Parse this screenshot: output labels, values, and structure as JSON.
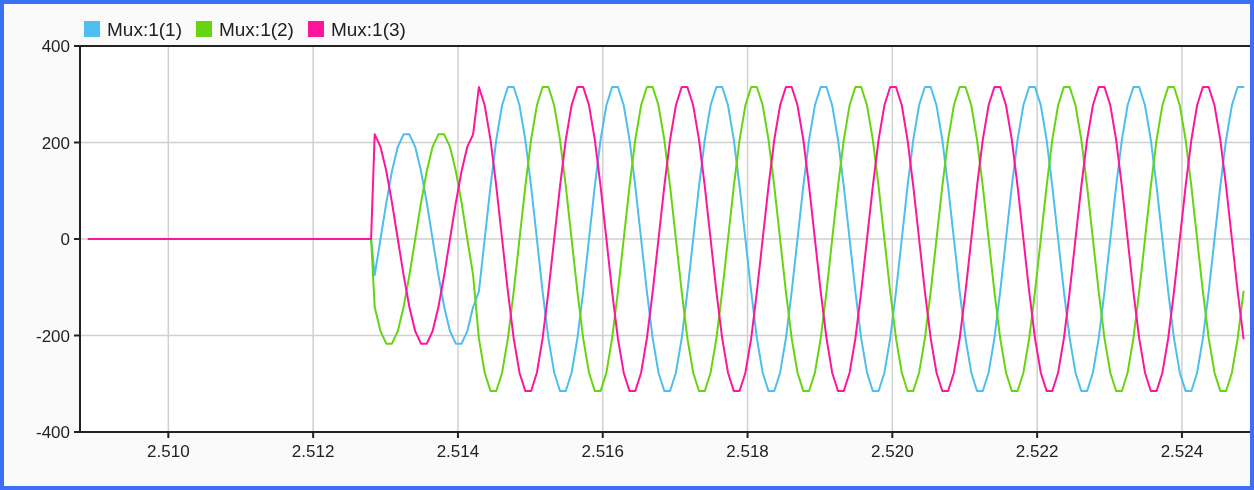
{
  "scope": {
    "chart_data": {
      "type": "line",
      "grid": true,
      "xlim": [
        2.50878,
        2.52494
      ],
      "ylim": [
        -400,
        400
      ],
      "yticks": [
        -400,
        -200,
        0,
        200,
        400
      ],
      "xticks": [
        {
          "value": 2.51,
          "label": "2.510"
        },
        {
          "value": 2.512,
          "label": "2.512"
        },
        {
          "value": 2.514,
          "label": "2.514"
        },
        {
          "value": 2.516,
          "label": "2.516"
        },
        {
          "value": 2.518,
          "label": "2.518"
        },
        {
          "value": 2.52,
          "label": "2.520"
        },
        {
          "value": 2.522,
          "label": "2.522"
        },
        {
          "value": 2.524,
          "label": "2.524"
        }
      ],
      "x": [
        2.5089,
        2.5128,
        2.51285,
        2.51293,
        2.51301,
        2.51309,
        2.51317,
        2.51325,
        2.51333,
        2.51341,
        2.51349,
        2.51357,
        2.51365,
        2.51373,
        2.51381,
        2.51389,
        2.51397,
        2.51405,
        2.51413,
        2.51421,
        2.51429,
        2.51437,
        2.51445,
        2.51453,
        2.51461,
        2.51469,
        2.51477,
        2.51485,
        2.51493,
        2.51501,
        2.51509,
        2.51517,
        2.51525,
        2.51533,
        2.51541,
        2.51549,
        2.51557,
        2.51565,
        2.51573,
        2.51581,
        2.51589,
        2.51597,
        2.51605,
        2.51613,
        2.51621,
        2.51629,
        2.51637,
        2.51645,
        2.51653,
        2.51661,
        2.51669,
        2.51677,
        2.51685,
        2.51693,
        2.51701,
        2.51709,
        2.51717,
        2.51725,
        2.51733,
        2.51741,
        2.51749,
        2.51757,
        2.51765,
        2.51773,
        2.51781,
        2.51789,
        2.51797,
        2.51805,
        2.51813,
        2.51821,
        2.51829,
        2.51837,
        2.51845,
        2.51853,
        2.51861,
        2.51869,
        2.51877,
        2.51885,
        2.51893,
        2.51901,
        2.51909,
        2.51917,
        2.51925,
        2.51933,
        2.51941,
        2.51949,
        2.51957,
        2.51965,
        2.51973,
        2.51981,
        2.51989,
        2.51997,
        2.52005,
        2.52013,
        2.52021,
        2.52029,
        2.52037,
        2.52045,
        2.52053,
        2.52061,
        2.52069,
        2.52077,
        2.52085,
        2.52093,
        2.52101,
        2.52109,
        2.52117,
        2.52125,
        2.52133,
        2.52141,
        2.52149,
        2.52157,
        2.52165,
        2.52173,
        2.52181,
        2.52189,
        2.52197,
        2.52205,
        2.52213,
        2.52221,
        2.52229,
        2.52237,
        2.52245,
        2.52253,
        2.52261,
        2.52269,
        2.52277,
        2.52285,
        2.52293,
        2.52301,
        2.52309,
        2.52317,
        2.52325,
        2.52333,
        2.52341,
        2.52349,
        2.52357,
        2.52365,
        2.52373,
        2.52381,
        2.52389,
        2.52397,
        2.52405,
        2.52413,
        2.52421,
        2.52429,
        2.52437,
        2.52445,
        2.52453,
        2.52461,
        2.52469,
        2.52477,
        2.52485
      ],
      "series": [
        {
          "name": "Mux:1(1)",
          "color": "#4dbeee",
          "values": [
            0,
            0,
            -75,
            0,
            75,
            141,
            191,
            217,
            217,
            191,
            141,
            75,
            0,
            -75,
            -141,
            -191,
            -217,
            -217,
            -191,
            -141,
            -109,
            0,
            109,
            206,
            277,
            315,
            315,
            277,
            206,
            109,
            0,
            -109,
            -206,
            -277,
            -315,
            -315,
            -277,
            -206,
            -109,
            0,
            109,
            206,
            277,
            315,
            315,
            277,
            206,
            109,
            0,
            -109,
            -206,
            -277,
            -315,
            -315,
            -277,
            -206,
            -109,
            0,
            109,
            206,
            277,
            315,
            315,
            277,
            206,
            109,
            0,
            -109,
            -206,
            -277,
            -315,
            -315,
            -277,
            -206,
            -109,
            0,
            109,
            206,
            277,
            315,
            315,
            277,
            206,
            109,
            0,
            -109,
            -206,
            -277,
            -315,
            -315,
            -277,
            -206,
            -109,
            0,
            109,
            206,
            277,
            315,
            315,
            277,
            206,
            109,
            0,
            -109,
            -206,
            -277,
            -315,
            -315,
            -277,
            -206,
            -109,
            0,
            109,
            206,
            277,
            315,
            315,
            277,
            206,
            109,
            0,
            -109,
            -206,
            -277,
            -315,
            -315,
            -277,
            -206,
            -109,
            0,
            109,
            206,
            277,
            315,
            315,
            277,
            206,
            109,
            0,
            -109,
            -206,
            -277,
            -315,
            -315,
            -277,
            -206,
            -109,
            0,
            109,
            206,
            277,
            315,
            315
          ]
        },
        {
          "name": "Mux:1(2)",
          "color": "#66d40e",
          "values": [
            0,
            0,
            -141,
            -191,
            -217,
            -217,
            -191,
            -141,
            -75,
            0,
            75,
            141,
            191,
            217,
            217,
            191,
            141,
            75,
            0,
            -75,
            -206,
            -277,
            -315,
            -315,
            -277,
            -206,
            -109,
            0,
            109,
            206,
            277,
            315,
            315,
            277,
            206,
            109,
            0,
            -109,
            -206,
            -277,
            -315,
            -315,
            -277,
            -206,
            -109,
            0,
            109,
            206,
            277,
            315,
            315,
            277,
            206,
            109,
            0,
            -109,
            -206,
            -277,
            -315,
            -315,
            -277,
            -206,
            -109,
            0,
            109,
            206,
            277,
            315,
            315,
            277,
            206,
            109,
            0,
            -109,
            -206,
            -277,
            -315,
            -315,
            -277,
            -206,
            -109,
            0,
            109,
            206,
            277,
            315,
            315,
            277,
            206,
            109,
            0,
            -109,
            -206,
            -277,
            -315,
            -315,
            -277,
            -206,
            -109,
            0,
            109,
            206,
            277,
            315,
            315,
            277,
            206,
            109,
            0,
            -109,
            -206,
            -277,
            -315,
            -315,
            -277,
            -206,
            -109,
            0,
            109,
            206,
            277,
            315,
            315,
            277,
            206,
            109,
            0,
            -109,
            -206,
            -277,
            -315,
            -315,
            -277,
            -206,
            -109,
            0,
            109,
            206,
            277,
            315,
            315,
            277,
            206,
            109,
            0,
            -109,
            -206,
            -277,
            -315,
            -315,
            -277,
            -206,
            -109
          ]
        },
        {
          "name": "Mux:1(3)",
          "color": "#ff149c",
          "values": [
            0,
            0,
            217,
            191,
            141,
            75,
            0,
            -75,
            -141,
            -191,
            -217,
            -217,
            -191,
            -141,
            -75,
            0,
            75,
            141,
            191,
            217,
            315,
            277,
            206,
            109,
            0,
            -109,
            -206,
            -277,
            -315,
            -315,
            -277,
            -206,
            -109,
            0,
            109,
            206,
            277,
            315,
            315,
            277,
            206,
            109,
            0,
            -109,
            -206,
            -277,
            -315,
            -315,
            -277,
            -206,
            -109,
            0,
            109,
            206,
            277,
            315,
            315,
            277,
            206,
            109,
            0,
            -109,
            -206,
            -277,
            -315,
            -315,
            -277,
            -206,
            -109,
            0,
            109,
            206,
            277,
            315,
            315,
            277,
            206,
            109,
            0,
            -109,
            -206,
            -277,
            -315,
            -315,
            -277,
            -206,
            -109,
            0,
            109,
            206,
            277,
            315,
            315,
            277,
            206,
            109,
            0,
            -109,
            -206,
            -277,
            -315,
            -315,
            -277,
            -206,
            -109,
            0,
            109,
            206,
            277,
            315,
            315,
            277,
            206,
            109,
            0,
            -109,
            -206,
            -277,
            -315,
            -315,
            -277,
            -206,
            -109,
            0,
            109,
            206,
            277,
            315,
            315,
            277,
            206,
            109,
            0,
            -109,
            -206,
            -277,
            -315,
            -315,
            -277,
            -206,
            -109,
            0,
            109,
            206,
            277,
            315,
            315,
            277,
            206,
            109,
            0,
            -109,
            -206
          ]
        }
      ]
    }
  }
}
